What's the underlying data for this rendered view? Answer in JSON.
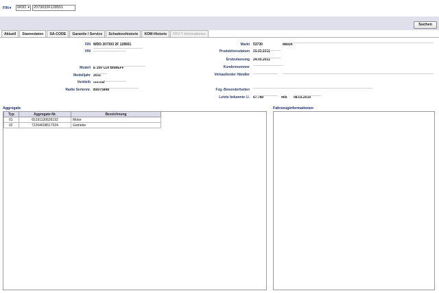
{
  "search": {
    "type_label": "FIN",
    "brand_value": "WDD",
    "fin_value": "2073032F128551",
    "search_button": "Suchen"
  },
  "tabs": [
    {
      "label": "Aktuell",
      "state": "normal"
    },
    {
      "label": "Stammdaten",
      "state": "active"
    },
    {
      "label": "SA-CODE",
      "state": "normal"
    },
    {
      "label": "Garantie / Service",
      "state": "normal"
    },
    {
      "label": "Schadenshistorie",
      "state": "normal"
    },
    {
      "label": "KDM-Historie",
      "state": "normal"
    },
    {
      "label": "FFV-T Informationen",
      "state": "disabled"
    }
  ],
  "left": {
    "fin": {
      "label": "FIN",
      "value": "WDD 207303 2F 128551"
    },
    "vin": {
      "label": "VIN",
      "value": ""
    },
    "modell": {
      "label": "Modell",
      "value": "E 250 CDI BlueEFF"
    },
    "modelljahr": {
      "label": "Modelljahr",
      "value": "2011"
    },
    "verbleib": {
      "label": "Verbleib",
      "value": "normal"
    },
    "radio": {
      "label": "Radio Seriennr.",
      "value": "B0075848"
    }
  },
  "right": {
    "markt": {
      "label": "Markt",
      "value": "53730",
      "value2": "MBUK"
    },
    "produktionsdatum": {
      "label": "Produktionsdatum",
      "value": "09.05.2011"
    },
    "erstzulassung": {
      "label": "Erstzulassung",
      "value": "24.05.2011"
    },
    "kundennummer": {
      "label": "Kundennummer",
      "value": ""
    },
    "haendler": {
      "label": "Verkaufender Händler",
      "value": ""
    },
    "besonderheiten": {
      "label": "Fzg.-Besonderheiten",
      "value": ""
    },
    "km": {
      "label": "Letzte bekannte l.l.",
      "value": "67.780",
      "unit": "mls",
      "date": "08.03.2019"
    }
  },
  "aggregate": {
    "title": "Aggregate",
    "columns": [
      "Typ",
      "Aggregate-Nr.",
      "Bezeichnung"
    ],
    "rows": [
      {
        "typ": "01",
        "nr": "65191130626192",
        "bez": "Motor"
      },
      {
        "typ": "02",
        "nr": "72264608517024",
        "bez": "Getriebe"
      }
    ]
  },
  "fahrzeug": {
    "title": "Fahrzeuginformationen"
  }
}
